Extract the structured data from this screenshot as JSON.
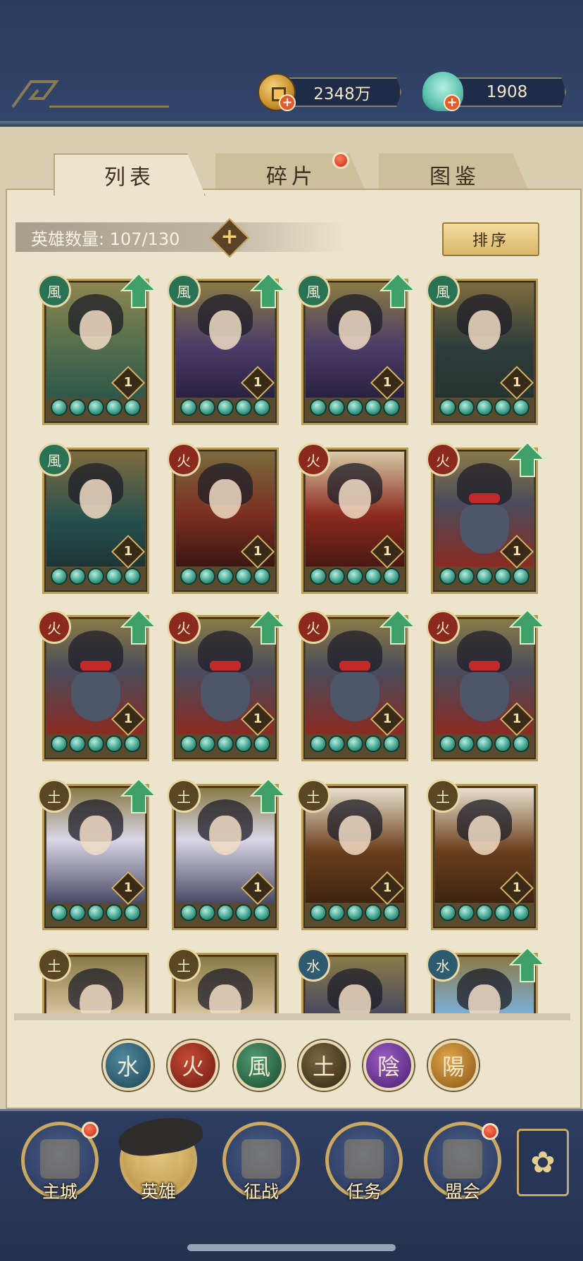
{
  "currency": {
    "coins": "2348万",
    "gems": "1908"
  },
  "tabs": [
    {
      "label": "列表",
      "active": true
    },
    {
      "label": "碎片",
      "active": false,
      "badge": true
    },
    {
      "label": "图鉴",
      "active": false
    }
  ],
  "hero_count": {
    "label": "英雄数量: 107/130",
    "plus": "+"
  },
  "sort_label": "排序",
  "elements": {
    "wind": "風",
    "fire": "火",
    "earth": "土",
    "water": "水",
    "yin": "陰",
    "yang": "陽"
  },
  "heroes": [
    {
      "element": "wind",
      "level": "1",
      "upgrade": true,
      "stars": 5
    },
    {
      "element": "wind",
      "level": "1",
      "upgrade": true,
      "stars": 5
    },
    {
      "element": "wind",
      "level": "1",
      "upgrade": true,
      "stars": 5
    },
    {
      "element": "wind",
      "level": "1",
      "upgrade": false,
      "stars": 5
    },
    {
      "element": "wind",
      "level": "1",
      "upgrade": false,
      "stars": 5
    },
    {
      "element": "fire",
      "level": "1",
      "upgrade": false,
      "stars": 5
    },
    {
      "element": "fire",
      "level": "1",
      "upgrade": false,
      "stars": 5
    },
    {
      "element": "fire",
      "level": "1",
      "upgrade": true,
      "stars": 5
    },
    {
      "element": "fire",
      "level": "1",
      "upgrade": true,
      "stars": 5
    },
    {
      "element": "fire",
      "level": "1",
      "upgrade": true,
      "stars": 5
    },
    {
      "element": "fire",
      "level": "1",
      "upgrade": true,
      "stars": 5
    },
    {
      "element": "fire",
      "level": "1",
      "upgrade": true,
      "stars": 5
    },
    {
      "element": "earth",
      "level": "1",
      "upgrade": true,
      "stars": 5
    },
    {
      "element": "earth",
      "level": "1",
      "upgrade": true,
      "stars": 5
    },
    {
      "element": "earth",
      "level": "1",
      "upgrade": false,
      "stars": 5
    },
    {
      "element": "earth",
      "level": "1",
      "upgrade": false,
      "stars": 5
    },
    {
      "element": "earth",
      "level": "",
      "upgrade": false,
      "stars": 0
    },
    {
      "element": "earth",
      "level": "",
      "upgrade": false,
      "stars": 0
    },
    {
      "element": "water",
      "level": "",
      "upgrade": false,
      "stars": 0
    },
    {
      "element": "water",
      "level": "",
      "upgrade": true,
      "stars": 0
    }
  ],
  "nav": [
    {
      "label": "主城",
      "badge": true
    },
    {
      "label": "英雄",
      "badge": false,
      "active": true
    },
    {
      "label": "征战",
      "badge": false
    },
    {
      "label": "任务",
      "badge": false
    },
    {
      "label": "盟会",
      "badge": true
    }
  ],
  "colors": {
    "upgrade_arrow": "#3fa06a",
    "badge_red": "#c82a1a",
    "frame_gold": "#b99a52"
  }
}
